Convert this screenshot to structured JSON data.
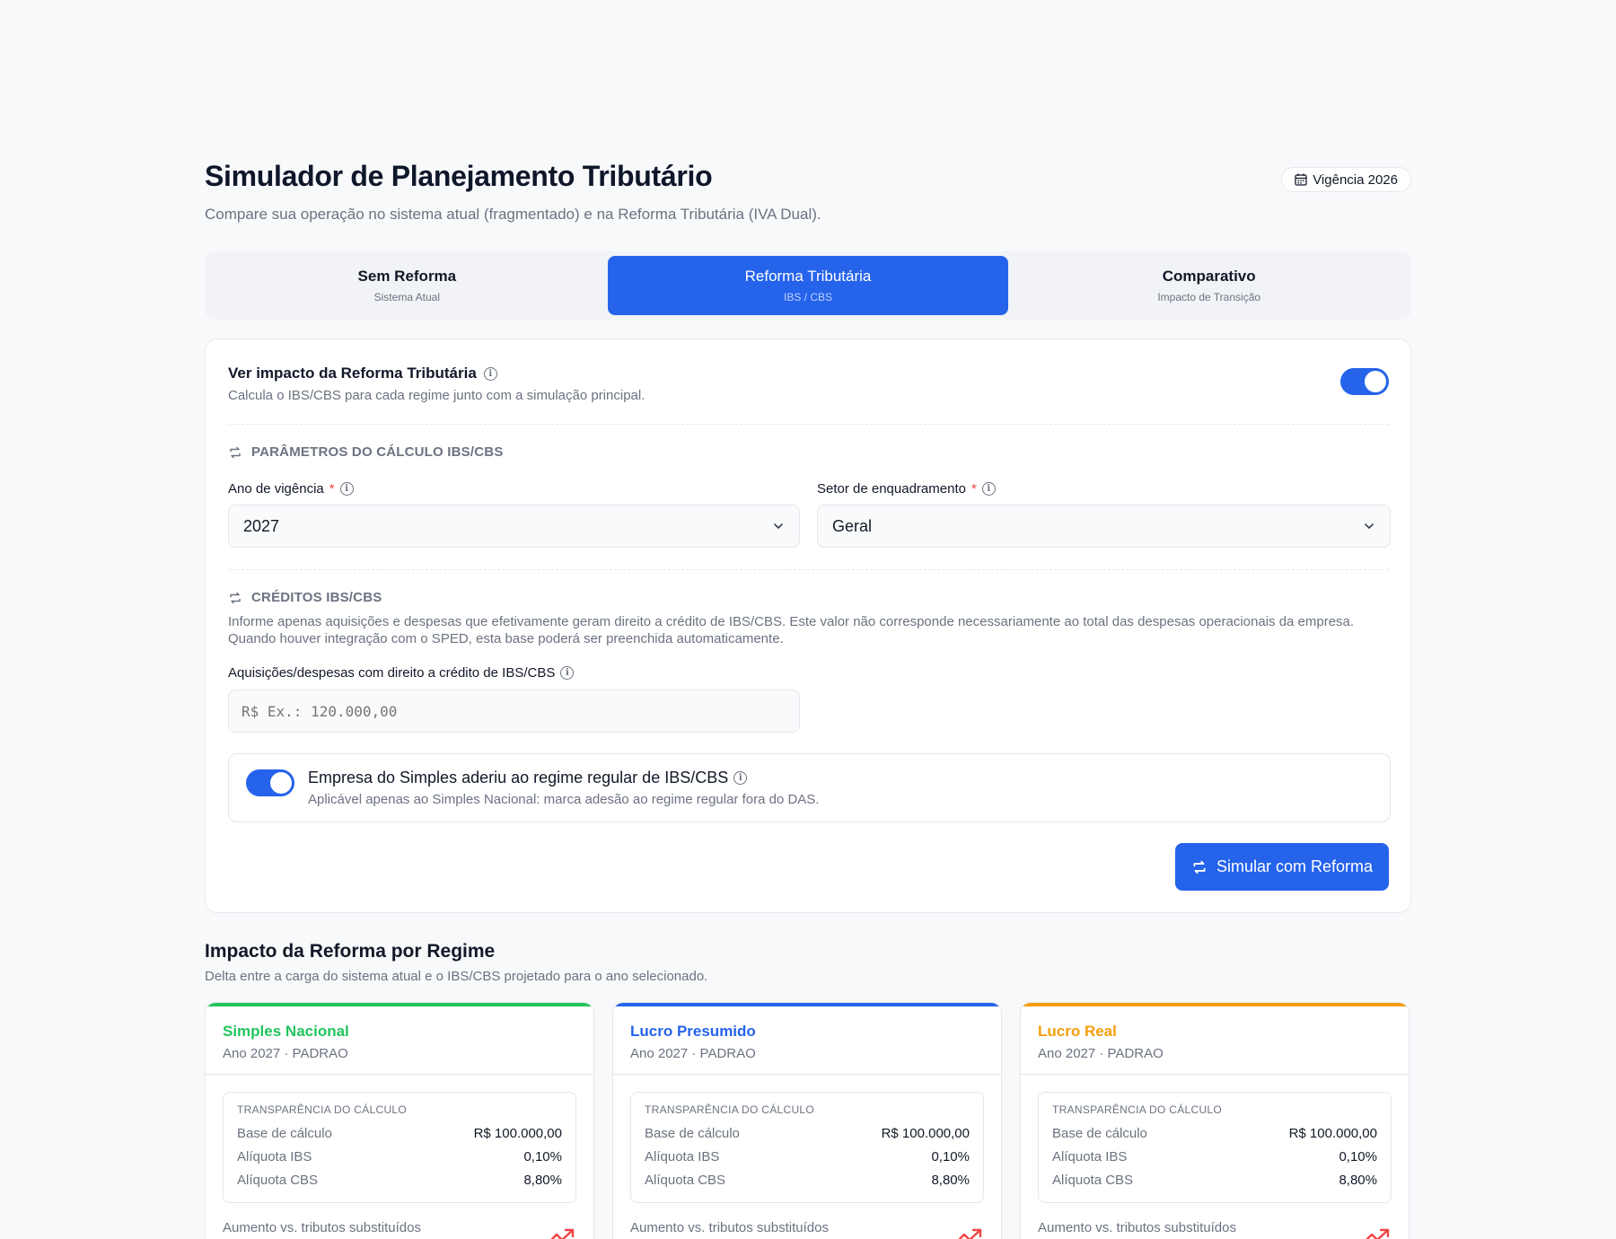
{
  "header": {
    "title": "Simulador de Planejamento Tributário",
    "subtitle": "Compare sua operação no sistema atual (fragmentado) e na Reforma Tributária (IVA Dual).",
    "vigencia_badge": "Vigência 2026"
  },
  "tabs": [
    {
      "label": "Sem Reforma",
      "sub": "Sistema Atual"
    },
    {
      "label": "Reforma Tributária",
      "sub": "IBS / CBS"
    },
    {
      "label": "Comparativo",
      "sub": "Impacto de Transição"
    }
  ],
  "impact_toggle": {
    "title": "Ver impacto da Reforma Tributária",
    "description": "Calcula o IBS/CBS para cada regime junto com a simulação principal.",
    "on": true
  },
  "params": {
    "section_title": "PARÂMETROS DO CÁLCULO IBS/CBS",
    "ano_label": "Ano de vigência",
    "ano_value": "2027",
    "setor_label": "Setor de enquadramento",
    "setor_value": "Geral",
    "required_mark": "*"
  },
  "creditos": {
    "section_title": "CRÉDITOS IBS/CBS",
    "description": "Informe apenas aquisições e despesas que efetivamente geram direito a crédito de IBS/CBS. Este valor não corresponde necessariamente ao total das despesas operacionais da empresa. Quando houver integração com o SPED, esta base poderá ser preenchida automaticamente.",
    "input_label": "Aquisições/despesas com direito a crédito de IBS/CBS",
    "input_placeholder": "R$ Ex.: 120.000,00"
  },
  "simples_option": {
    "title": "Empresa do Simples aderiu ao regime regular de IBS/CBS",
    "description": "Aplicável apenas ao Simples Nacional: marca adesão ao regime regular fora do DAS.",
    "on": true
  },
  "simulate_button": "Simular com Reforma",
  "impact": {
    "title": "Impacto da Reforma por Regime",
    "subtitle": "Delta entre a carga do sistema atual e o IBS/CBS projetado para o ano selecionado.",
    "transp_title": "TRANSPARÊNCIA DO CÁLCULO",
    "base_label": "Base de cálculo",
    "ibs_label": "Alíquota IBS",
    "cbs_label": "Alíquota CBS",
    "aumento_label": "Aumento vs. tributos substituídos",
    "regimes": [
      {
        "name": "Simples Nacional",
        "year": "Ano 2027 · PADRAO",
        "color": "#22c55e",
        "base": "R$ 100.000,00",
        "ibs": "0,10%",
        "cbs": "8,80%"
      },
      {
        "name": "Lucro Presumido",
        "year": "Ano 2027 · PADRAO",
        "color": "#2563eb",
        "base": "R$ 100.000,00",
        "ibs": "0,10%",
        "cbs": "8,80%"
      },
      {
        "name": "Lucro Real",
        "year": "Ano 2027 · PADRAO",
        "color": "#f59e0b",
        "base": "R$ 100.000,00",
        "ibs": "0,10%",
        "cbs": "8,80%"
      }
    ]
  },
  "colors": {
    "accent": "#2563eb",
    "trend": "#ef4444"
  }
}
